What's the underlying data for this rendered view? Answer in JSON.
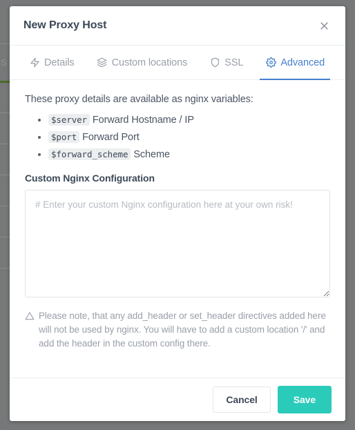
{
  "modal": {
    "title": "New Proxy Host",
    "close_icon": "close-icon",
    "tabs": [
      {
        "label": "Details",
        "icon": "zap-icon",
        "active": false
      },
      {
        "label": "Custom locations",
        "icon": "layers-icon",
        "active": false
      },
      {
        "label": "SSL",
        "icon": "shield-icon",
        "active": false
      },
      {
        "label": "Advanced",
        "icon": "gear-icon",
        "active": true
      }
    ],
    "body": {
      "intro": "These proxy details are available as nginx variables:",
      "variables": [
        {
          "code": "$server",
          "description": "Forward Hostname / IP"
        },
        {
          "code": "$port",
          "description": "Forward Port"
        },
        {
          "code": "$forward_scheme",
          "description": "Scheme"
        }
      ],
      "config_label": "Custom Nginx Configuration",
      "config_placeholder": "# Enter your custom Nginx configuration here at your own risk!",
      "config_value": "",
      "note_icon": "warning-triangle-icon",
      "note_text": "Please note, that any add_header or set_header directives added here will not be used by nginx. You will have to add a custom location '/' and add the header in the custom config there."
    },
    "footer": {
      "cancel_label": "Cancel",
      "save_label": "Save"
    }
  },
  "colors": {
    "accent_blue": "#467fcf",
    "save_teal": "#2bcbba",
    "backdrop": "#777879",
    "text": "#3c4858",
    "muted": "#9aa0a9"
  },
  "background": {
    "ghost_text": "S"
  }
}
